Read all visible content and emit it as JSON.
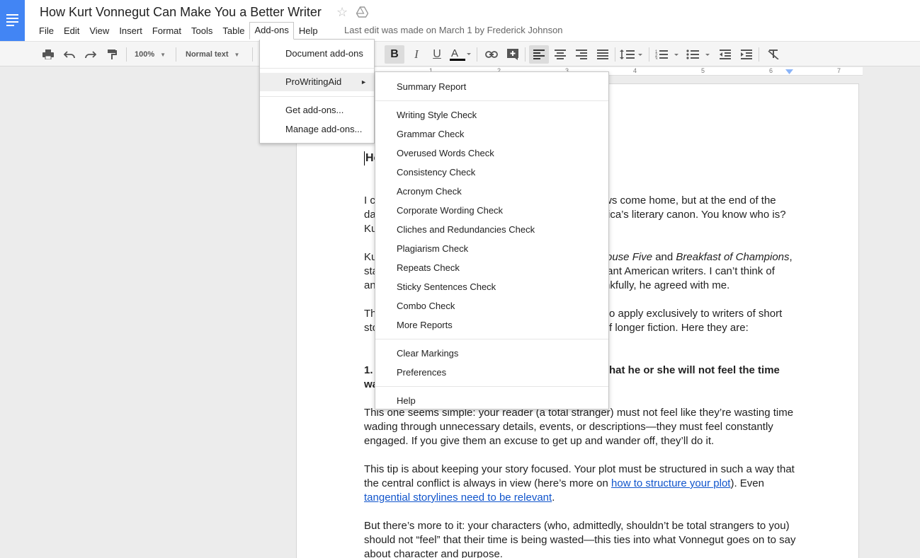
{
  "header": {
    "title": "How Kurt Vonnegut Can Make You a Better Writer",
    "last_edit": "Last edit was made on March 1 by Frederick Johnson",
    "menus": [
      "File",
      "Edit",
      "View",
      "Insert",
      "Format",
      "Tools",
      "Table",
      "Add-ons",
      "Help"
    ]
  },
  "toolbar": {
    "zoom": "100%",
    "style": "Normal text"
  },
  "ruler": [
    "1",
    "2",
    "3",
    "4",
    "5",
    "6",
    "7"
  ],
  "addons_menu": {
    "document_addons": "Document add-ons",
    "prowritingaid": "ProWritingAid",
    "arrow": "►",
    "get_addons": "Get add-ons...",
    "manage_addons": "Manage add-ons..."
  },
  "submenu": {
    "items": [
      "Summary Report",
      "Writing Style Check",
      "Grammar Check",
      "Overused Words Check",
      "Consistency Check",
      "Acronym Check",
      "Corporate Wording Check",
      "Cliches and Redundancies Check",
      "Plagiarism Check",
      "Repeats Check",
      "Sticky Sentences Check",
      "Combo Check",
      "More Reports",
      "Clear Markings",
      "Preferences",
      "Help"
    ]
  },
  "document": {
    "heading_fragment": "Ho",
    "p1": [
      "I c",
      "ws come home, but at the end of the",
      "da",
      "rica’s literary canon. You know who is?",
      "Ku"
    ],
    "p2": [
      "Ku",
      "ouse Five",
      " and ",
      "Breakfast of Champions",
      ",",
      "sta",
      "tant American writers. I can’t think of",
      "an",
      "nkfully, he agreed with me."
    ],
    "p3": [
      "Th",
      "o apply exclusively to writers of short",
      "sto",
      "f longer fiction. Here they are:"
    ],
    "rule1": [
      "1.",
      "hat he or she will not feel the time",
      "wa"
    ],
    "p4": [
      "This one seems simple: your reader (a total stranger) must not feel like they’re wasting time",
      "wading through unnecessary details, events, or descriptions—they must feel constantly",
      "engaged. If you give them an excuse to get up and wander off, they’ll do it."
    ],
    "p5_line1": "This tip is about keeping your story focused. Your plot must be structured in such a way that",
    "p5_line2_pre": "the central conflict is always in view (here’s more on ",
    "p5_link1": "how to structure your plot",
    "p5_line2_post": "). Even",
    "p5_link2": "tangential storylines need to be relevant",
    "p5_end": ".",
    "p6": [
      "But there’s more to it: your characters (who, admittedly, shouldn’t be total strangers to you)",
      "should not “feel” that their time is being wasted—this ties into what Vonnegut goes on to say",
      "about character and purpose."
    ]
  }
}
